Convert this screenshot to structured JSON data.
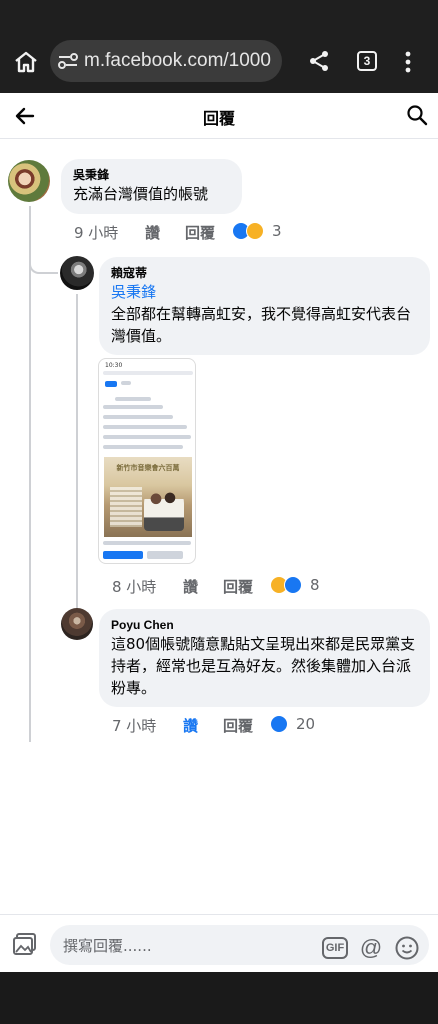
{
  "browser": {
    "url": "m.facebook.com/1000",
    "tab_count": "3",
    "icons": [
      "home-icon",
      "site-settings-icon",
      "share-icon",
      "tabs-icon",
      "more-vertical-icon"
    ]
  },
  "header": {
    "title": "回覆",
    "icons": [
      "back-arrow-icon",
      "search-icon"
    ]
  },
  "comments": [
    {
      "author": "吳秉鋒",
      "text": "充滿台灣價值的帳號",
      "time": "9 小時",
      "like_label": "讚",
      "reply_label": "回覆",
      "reactions": [
        "like",
        "haha"
      ],
      "reaction_count": "3"
    },
    {
      "author": "賴寇蒂",
      "mention": "吳秉鋒",
      "text": "全部都在幫轉高虹安，我不覺得高虹安代表台灣價值。",
      "time": "8 小時",
      "like_label": "讚",
      "reply_label": "回覆",
      "reactions": [
        "haha",
        "like"
      ],
      "reaction_count": "8",
      "attachment": {
        "status_time": "10:30",
        "headline": "新竹市音樂會六百萬"
      }
    },
    {
      "author": "Poyu Chen",
      "text": "這80個帳號隨意點貼文呈現出來都是民眾黨支持者，經常也是互為好友。然後集體加入台派粉專。",
      "time": "7 小時",
      "like_label": "讚",
      "like_active": true,
      "reply_label": "回覆",
      "reactions": [
        "like"
      ],
      "reaction_count": "20"
    }
  ],
  "composer": {
    "placeholder": "撰寫回覆......",
    "gif_label": "GIF",
    "at_label": "@",
    "icons": [
      "photo-icon",
      "gif-icon",
      "mention-icon",
      "emoji-icon"
    ]
  },
  "colors": {
    "accent": "#1877f2",
    "bubble": "#f0f2f5",
    "meta_text": "#65676b",
    "browser_bar": "#1f1f1f"
  }
}
